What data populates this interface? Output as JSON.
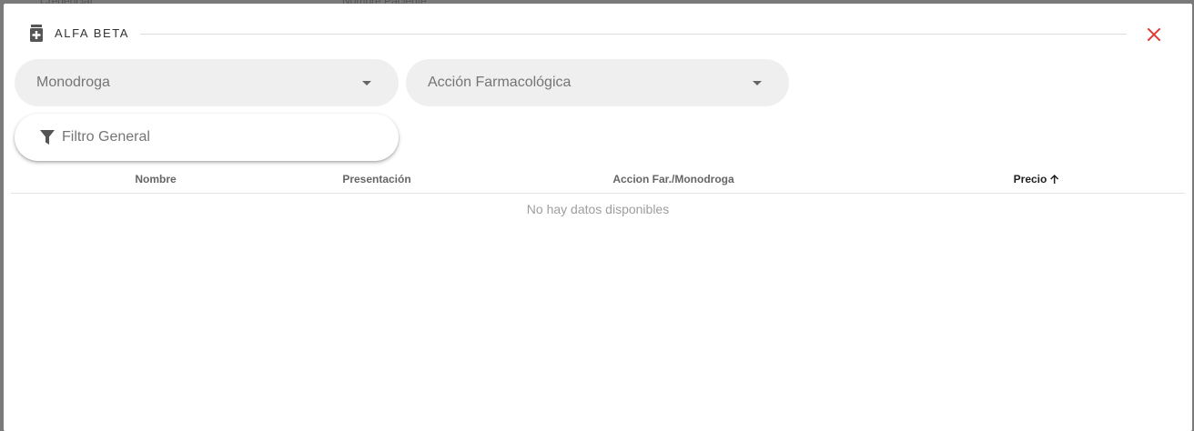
{
  "backdrop": {
    "left_text": "Credencial",
    "right_text": "Nombre Paciente"
  },
  "dialog": {
    "title": "ALFA BETA",
    "title_icon": "medical-box-icon",
    "close_icon": "close-icon",
    "accent_color": "#e53935"
  },
  "filters": {
    "monodroga_label": "Monodroga",
    "accion_label": "Acción Farmacológica",
    "general_placeholder": "Filtro General"
  },
  "table": {
    "columns": [
      {
        "label": "Nombre"
      },
      {
        "label": "Presentación"
      },
      {
        "label": "Accion Far./Monodroga"
      },
      {
        "label": "Precio",
        "sort": "ascending"
      }
    ],
    "empty_message": "No hay datos disponibles"
  }
}
